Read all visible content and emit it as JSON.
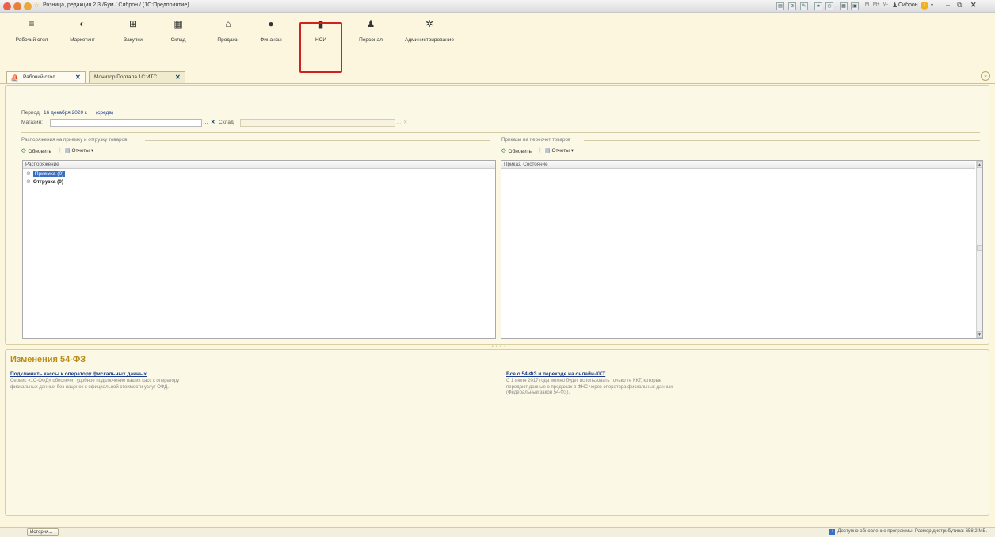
{
  "window": {
    "title": "Розница, редакция 2.3 /Бум / Сиброн / (1С:Предприятие)",
    "user": "Сиброн"
  },
  "sections": [
    {
      "label": "Рабочий стол",
      "icon": "desktop-icon",
      "glyph": "≡"
    },
    {
      "label": "Маркетинг",
      "icon": "marketing-icon",
      "glyph": "◐"
    },
    {
      "label": "Закупки",
      "icon": "purchases-icon",
      "glyph": "⊞"
    },
    {
      "label": "Склад",
      "icon": "warehouse-icon",
      "glyph": "▦"
    },
    {
      "label": "Продажи",
      "icon": "sales-icon",
      "glyph": "⌂"
    },
    {
      "label": "Финансы",
      "icon": "finance-icon",
      "glyph": "●"
    },
    {
      "label": "НСИ",
      "icon": "nsi-icon",
      "glyph": "▮"
    },
    {
      "label": "Персонал",
      "icon": "personnel-icon",
      "glyph": "♟"
    },
    {
      "label": "Администрирование",
      "icon": "admin-icon",
      "glyph": "✲"
    }
  ],
  "tabs": [
    {
      "label": "Рабочий стол"
    },
    {
      "label": "Монитор Портала 1С:ИТС"
    }
  ],
  "main": {
    "period_label": "Период:",
    "period_value": "16 декабря 2020 г.",
    "period_weekday": "(среда)",
    "shop_label": "Магазин:",
    "shop_value": "",
    "warehouse_label": "Склад:",
    "warehouse_value": "",
    "left_group": {
      "title": "Распоряжения на приемку и отгрузку товаров",
      "refresh": "Обновить",
      "reports": "Отчеты",
      "column": "Распоряжение",
      "rows": [
        {
          "label": "Приемка (0)"
        },
        {
          "label": "Отгрузка (0)"
        }
      ]
    },
    "right_group": {
      "title": "Приказы на пересчет товаров",
      "refresh": "Обновить",
      "reports": "Отчеты",
      "column": "Приказ, Состояние"
    }
  },
  "news": {
    "title": "Изменения 54-ФЗ",
    "items": [
      {
        "link": "Подключить кассы к оператору фискальных данных",
        "text": "Сервис «1С-ОФД» обеспечит удобное подключение ваших касс к оператору фискальных данных без наценок к официальной стоимости услуг ОФД."
      },
      {
        "link": "Все о 54-ФЗ и переходе на онлайн-ККТ",
        "text": "С 1 июля 2017 года можно будет использовать только те ККТ, которые передают данные о продажах в ФНС через оператора фискальных данных (Федеральный закон 54-ФЗ)."
      }
    ]
  },
  "status": {
    "history_button": "История...",
    "message": "Доступно обновление программы. Размер дистрибутива: 658,2 МБ."
  },
  "colors": {
    "accent_highlight": "#d02020",
    "news_title": "#b98d14",
    "link": "#1c3c8c",
    "selection": "#3a6fc4",
    "background": "#fbf6dd"
  }
}
